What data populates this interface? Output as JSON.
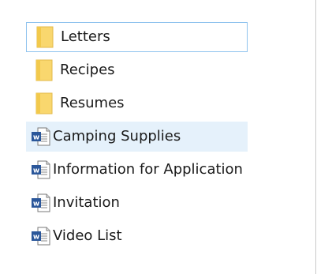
{
  "files": [
    {
      "name": "Letters",
      "type": "folder"
    },
    {
      "name": "Recipes",
      "type": "folder"
    },
    {
      "name": "Resumes",
      "type": "folder"
    },
    {
      "name": "Camping Supplies",
      "type": "word-document"
    },
    {
      "name": "Information for Application",
      "type": "word-document"
    },
    {
      "name": "Invitation",
      "type": "word-document"
    },
    {
      "name": "Video List",
      "type": "word-document"
    }
  ],
  "icons": {
    "folder": "folder-icon",
    "document": "word-document-icon"
  },
  "colors": {
    "folder_fill": "#f9d76e",
    "folder_edge": "#e3b94a",
    "word_blue": "#2b579a",
    "focus_border": "#8fc3ee",
    "hover_background": "#e5f1fb"
  }
}
